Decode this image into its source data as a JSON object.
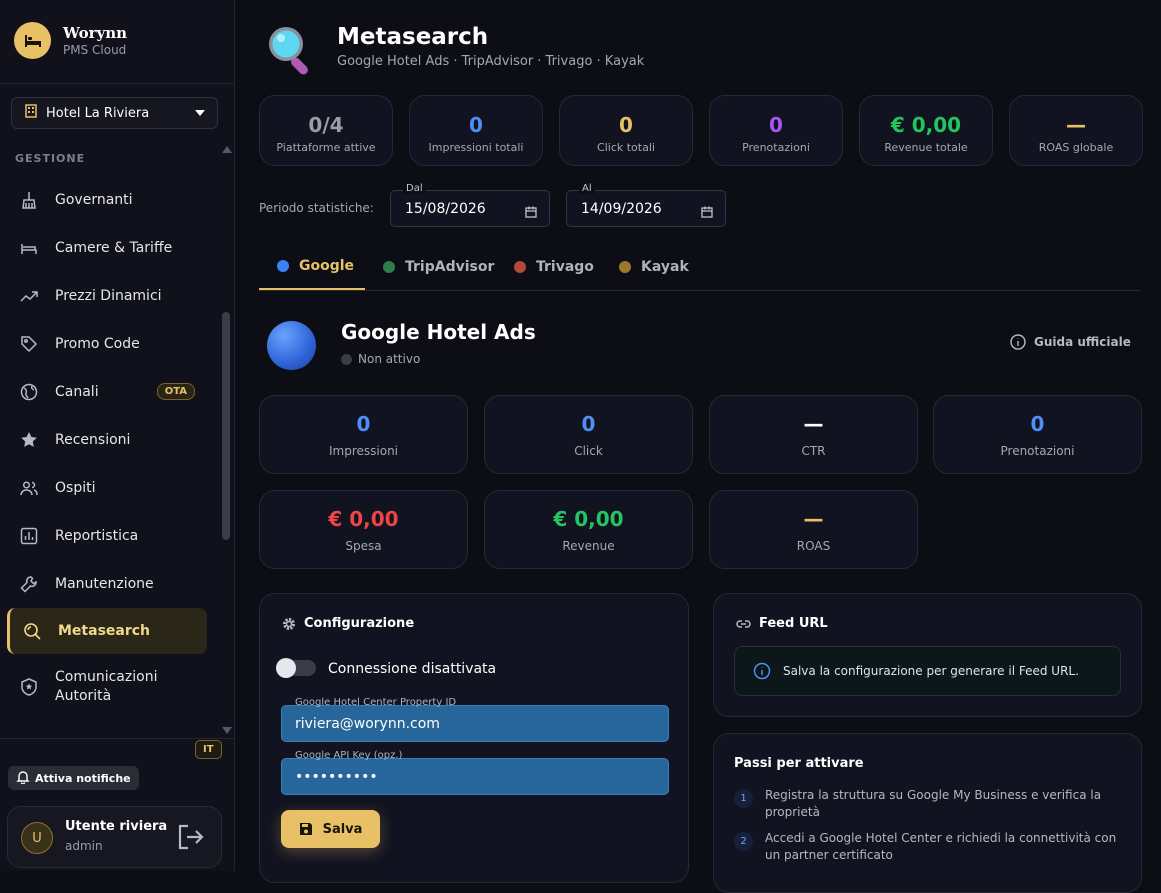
{
  "brand": {
    "name": "Worynn",
    "sub": "PMS Cloud"
  },
  "hotel": {
    "selected": "Hotel La Riviera"
  },
  "sidebar": {
    "section": "GESTIONE",
    "items": [
      {
        "label": "Governanti",
        "icon": "broom-icon"
      },
      {
        "label": "Camere & Tariffe",
        "icon": "bed-icon"
      },
      {
        "label": "Prezzi Dinamici",
        "icon": "trending-up-icon"
      },
      {
        "label": "Promo Code",
        "icon": "tag-icon"
      },
      {
        "label": "Canali",
        "icon": "globe-icon",
        "badge": "OTA"
      },
      {
        "label": "Recensioni",
        "icon": "star-icon"
      },
      {
        "label": "Ospiti",
        "icon": "users-icon"
      },
      {
        "label": "Reportistica",
        "icon": "chart-icon"
      },
      {
        "label": "Manutenzione",
        "icon": "wrench-icon"
      },
      {
        "label": "Metasearch",
        "icon": "search-globe-icon",
        "active": true
      },
      {
        "label": "Comunicazioni Autorità",
        "icon": "shield-icon"
      }
    ],
    "lang": "IT",
    "notif_label": "Attiva notifiche",
    "user": {
      "initial": "U",
      "name": "Utente riviera",
      "role": "admin"
    }
  },
  "header": {
    "title": "Metasearch",
    "subtitle": "Google Hotel Ads · TripAdvisor · Trivago · Kayak"
  },
  "kpis": [
    {
      "value": "0/4",
      "label": "Piattaforme attive",
      "color": "#9a9ca8"
    },
    {
      "value": "0",
      "label": "Impressioni totali",
      "color": "#4f8ef7"
    },
    {
      "value": "0",
      "label": "Click totali",
      "color": "#e8c167"
    },
    {
      "value": "0",
      "label": "Prenotazioni",
      "color": "#a855f7"
    },
    {
      "value": "€ 0,00",
      "label": "Revenue totale",
      "color": "#22c55e"
    },
    {
      "value": "—",
      "label": "ROAS globale",
      "color": "#e8c167"
    }
  ],
  "period": {
    "label": "Periodo statistiche:",
    "from_label": "Dal",
    "from": "15/08/2026",
    "to_label": "Al",
    "to": "14/09/2026"
  },
  "tabs": [
    {
      "label": "Google",
      "color": "#3b82f6",
      "active": true
    },
    {
      "label": "TripAdvisor",
      "color": "#2e7d4f"
    },
    {
      "label": "Trivago",
      "color": "#b04a3a"
    },
    {
      "label": "Kayak",
      "color": "#9a7a2a"
    }
  ],
  "platform": {
    "name": "Google Hotel Ads",
    "status": "Non attivo",
    "guide": "Guida ufficiale"
  },
  "stats": [
    {
      "value": "0",
      "label": "Impressioni",
      "color": "#4f8ef7"
    },
    {
      "value": "0",
      "label": "Click",
      "color": "#4f8ef7"
    },
    {
      "value": "—",
      "label": "CTR",
      "color": "#ffffff"
    },
    {
      "value": "0",
      "label": "Prenotazioni",
      "color": "#4f8ef7"
    },
    {
      "value": "€ 0,00",
      "label": "Spesa",
      "color": "#ef4444"
    },
    {
      "value": "€ 0,00",
      "label": "Revenue",
      "color": "#22c55e"
    },
    {
      "value": "—",
      "label": "ROAS",
      "color": "#e8c167"
    }
  ],
  "config": {
    "title": "Configurazione",
    "toggle_label": "Connessione disattivata",
    "property_label": "Google Hotel Center Property ID",
    "property_value": "riviera@worynn.com",
    "apikey_label": "Google API Key (opz.)",
    "apikey_value": "••••••••••",
    "save": "Salva"
  },
  "feed": {
    "title": "Feed URL",
    "info": "Salva la configurazione per generare il Feed URL."
  },
  "steps": {
    "title": "Passi per attivare",
    "items": [
      {
        "n": "1",
        "text": "Registra la struttura su Google My Business e verifica la proprietà"
      },
      {
        "n": "2",
        "text": "Accedi a Google Hotel Center e richiedi la connettività con un partner certificato"
      }
    ]
  }
}
